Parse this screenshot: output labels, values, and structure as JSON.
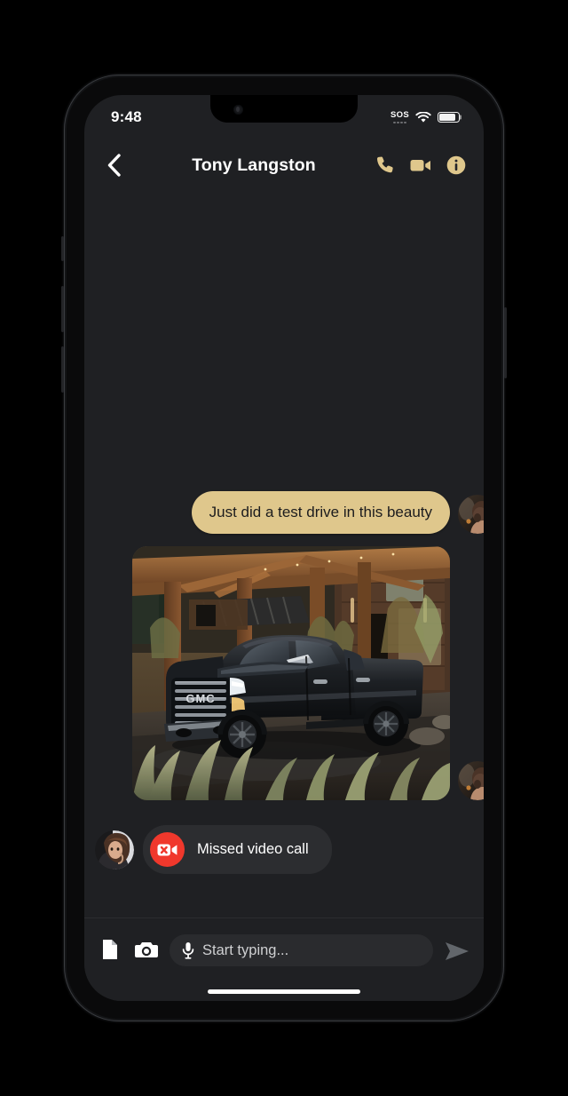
{
  "device": {
    "home_indicator": "home-indicator"
  },
  "status_bar": {
    "time": "9:48",
    "sos_label": "SOS",
    "wifi_icon": "wifi-icon",
    "battery_icon": "battery-icon",
    "battery_level_percent": 88
  },
  "header": {
    "back_icon": "chevron-left-icon",
    "title": "Tony Langston",
    "actions": [
      {
        "name": "voice-call-button",
        "icon": "phone-icon"
      },
      {
        "name": "video-call-button",
        "icon": "video-camera-icon"
      },
      {
        "name": "contact-info-button",
        "icon": "info-circle-icon"
      }
    ],
    "accent_color": "#dfc78c"
  },
  "conversation": {
    "messages": [
      {
        "type": "text",
        "direction": "outgoing",
        "text": "Just did a test drive in this beauty",
        "bubble_color": "#dfc78c",
        "text_color": "#1c1c1e",
        "avatar": "sender-avatar"
      },
      {
        "type": "image",
        "direction": "outgoing",
        "alt": "Black GMC Sierra Denali pickup truck parked under a wooden carport beside a modern timber house with ornamental grasses",
        "avatar": "sender-avatar"
      },
      {
        "type": "missed_call",
        "direction": "incoming",
        "label": "Missed video call",
        "icon": "missed-video-call-icon",
        "icon_background": "#f0382c",
        "bubble_color": "#2c2d30",
        "avatar": "contact-avatar"
      }
    ]
  },
  "composer": {
    "attach_file_icon": "document-icon",
    "camera_icon": "camera-icon",
    "mic_icon": "microphone-icon",
    "input_value": "",
    "input_placeholder": "Start typing...",
    "send_icon": "send-arrow-icon"
  },
  "theme": {
    "screen_background": "#1f2023",
    "accent": "#dfc78c",
    "danger": "#f0382c",
    "bubble_incoming": "#2c2d30"
  }
}
